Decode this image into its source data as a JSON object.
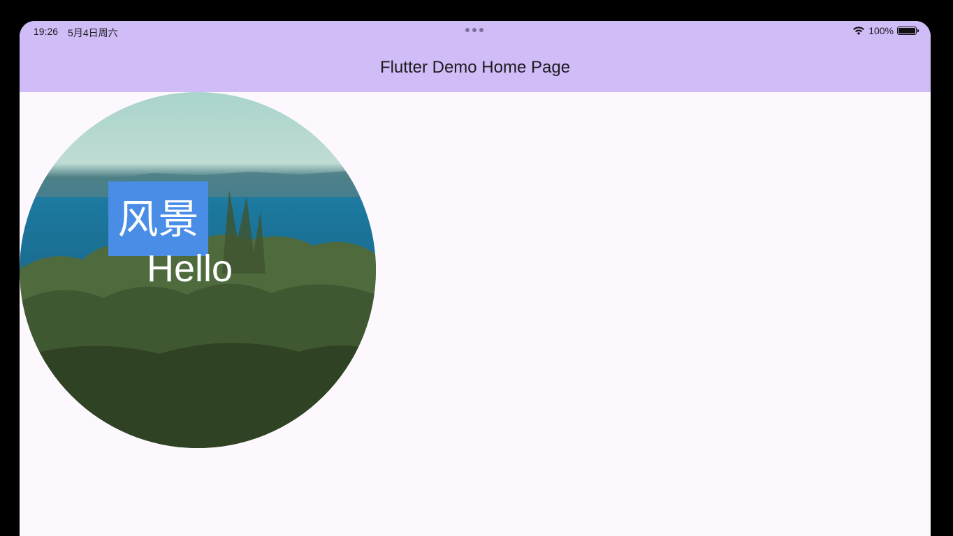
{
  "status_bar": {
    "time": "19:26",
    "date": "5月4日周六",
    "battery": "100%"
  },
  "app_bar": {
    "title": "Flutter Demo Home Page"
  },
  "content": {
    "badge_text": "风景",
    "overlay_text": "Hello"
  },
  "colors": {
    "app_bar": "#d0bcf7",
    "background": "#fdf8fd",
    "badge": "#4a8de6"
  }
}
